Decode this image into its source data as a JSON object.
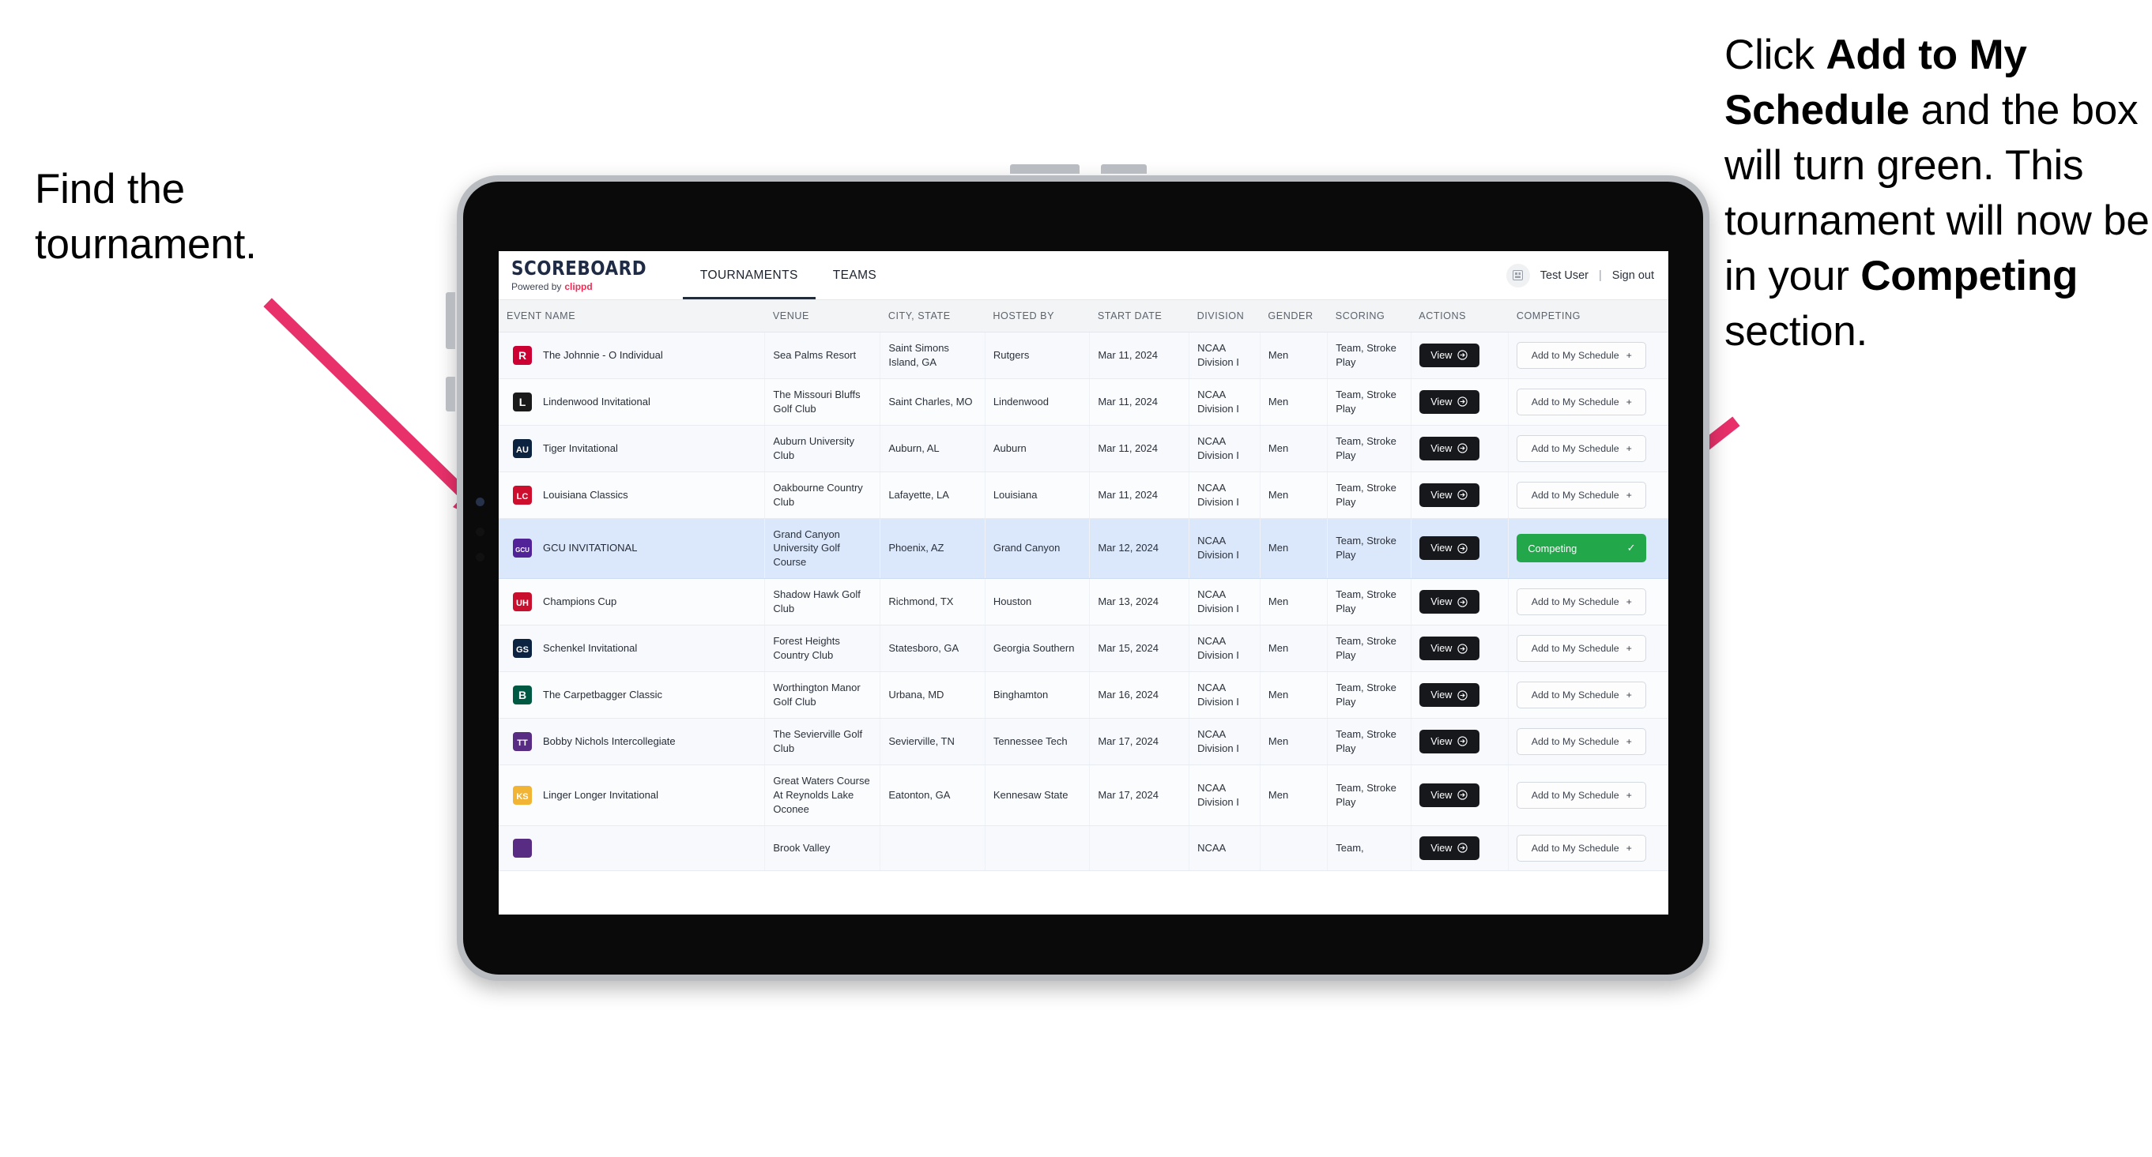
{
  "annotations": {
    "left": "Find the tournament.",
    "right_parts": [
      {
        "text": "Click ",
        "bold": false
      },
      {
        "text": "Add to My Schedule",
        "bold": true
      },
      {
        "text": " and the box will turn green. This tournament will now be in your ",
        "bold": false
      },
      {
        "text": "Competing",
        "bold": true
      },
      {
        "text": " section.",
        "bold": false
      }
    ],
    "arrow_color": "#e8306b"
  },
  "app": {
    "brand": {
      "title": "SCOREBOARD",
      "powered_prefix": "Powered by",
      "powered_name": "clippd"
    },
    "nav_tabs": [
      {
        "label": "TOURNAMENTS",
        "active": true
      },
      {
        "label": "TEAMS",
        "active": false
      }
    ],
    "account": {
      "user": "Test User",
      "separator": "|",
      "sign_out": "Sign out",
      "icon": "apps-grid-icon"
    },
    "table": {
      "columns": [
        "EVENT NAME",
        "VENUE",
        "CITY, STATE",
        "HOSTED BY",
        "START DATE",
        "DIVISION",
        "GENDER",
        "SCORING",
        "ACTIONS",
        "COMPETING"
      ],
      "view_label": "View",
      "add_label": "Add to My Schedule",
      "competing_label": "Competing",
      "rows": [
        {
          "event": "The Johnnie - O Individual",
          "venue": "Sea Palms Resort",
          "city": "Saint Simons Island, GA",
          "host": "Rutgers",
          "date": "Mar 11, 2024",
          "division": "NCAA Division I",
          "gender": "Men",
          "scoring": "Team, Stroke Play",
          "competing": false,
          "logo_color": "#cc0033",
          "logo_letter": "R"
        },
        {
          "event": "Lindenwood Invitational",
          "venue": "The Missouri Bluffs Golf Club",
          "city": "Saint Charles, MO",
          "host": "Lindenwood",
          "date": "Mar 11, 2024",
          "division": "NCAA Division I",
          "gender": "Men",
          "scoring": "Team, Stroke Play",
          "competing": false,
          "logo_color": "#1a1a1a",
          "logo_letter": "L"
        },
        {
          "event": "Tiger Invitational",
          "venue": "Auburn University Club",
          "city": "Auburn, AL",
          "host": "Auburn",
          "date": "Mar 11, 2024",
          "division": "NCAA Division I",
          "gender": "Men",
          "scoring": "Team, Stroke Play",
          "competing": false,
          "logo_color": "#0c2340",
          "logo_letter": "AU"
        },
        {
          "event": "Louisiana Classics",
          "venue": "Oakbourne Country Club",
          "city": "Lafayette, LA",
          "host": "Louisiana",
          "date": "Mar 11, 2024",
          "division": "NCAA Division I",
          "gender": "Men",
          "scoring": "Team, Stroke Play",
          "competing": false,
          "logo_color": "#ce0e2d",
          "logo_letter": "LC"
        },
        {
          "event": "GCU INVITATIONAL",
          "venue": "Grand Canyon University Golf Course",
          "city": "Phoenix, AZ",
          "host": "Grand Canyon",
          "date": "Mar 12, 2024",
          "division": "NCAA Division I",
          "gender": "Men",
          "scoring": "Team, Stroke Play",
          "competing": true,
          "highlight": true,
          "logo_color": "#522398",
          "logo_letter": "GCU"
        },
        {
          "event": "Champions Cup",
          "venue": "Shadow Hawk Golf Club",
          "city": "Richmond, TX",
          "host": "Houston",
          "date": "Mar 13, 2024",
          "division": "NCAA Division I",
          "gender": "Men",
          "scoring": "Team, Stroke Play",
          "competing": false,
          "logo_color": "#c8102e",
          "logo_letter": "UH"
        },
        {
          "event": "Schenkel Invitational",
          "venue": "Forest Heights Country Club",
          "city": "Statesboro, GA",
          "host": "Georgia Southern",
          "date": "Mar 15, 2024",
          "division": "NCAA Division I",
          "gender": "Men",
          "scoring": "Team, Stroke Play",
          "competing": false,
          "logo_color": "#0b2341",
          "logo_letter": "GS"
        },
        {
          "event": "The Carpetbagger Classic",
          "venue": "Worthington Manor Golf Club",
          "city": "Urbana, MD",
          "host": "Binghamton",
          "date": "Mar 16, 2024",
          "division": "NCAA Division I",
          "gender": "Men",
          "scoring": "Team, Stroke Play",
          "competing": false,
          "logo_color": "#005a43",
          "logo_letter": "B"
        },
        {
          "event": "Bobby Nichols Intercollegiate",
          "venue": "The Sevierville Golf Club",
          "city": "Sevierville, TN",
          "host": "Tennessee Tech",
          "date": "Mar 17, 2024",
          "division": "NCAA Division I",
          "gender": "Men",
          "scoring": "Team, Stroke Play",
          "competing": false,
          "logo_color": "#582c83",
          "logo_letter": "TT"
        },
        {
          "event": "Linger Longer Invitational",
          "venue": "Great Waters Course At Reynolds Lake Oconee",
          "city": "Eatonton, GA",
          "host": "Kennesaw State",
          "date": "Mar 17, 2024",
          "division": "NCAA Division I",
          "gender": "Men",
          "scoring": "Team, Stroke Play",
          "competing": false,
          "logo_color": "#f1b434",
          "logo_letter": "KS"
        },
        {
          "event": "",
          "venue": "Brook Valley",
          "city": "",
          "host": "",
          "date": "",
          "division": "NCAA",
          "gender": "",
          "scoring": "Team,",
          "competing": false,
          "cut_off": true,
          "logo_color": "#582c83",
          "logo_letter": ""
        }
      ]
    }
  }
}
